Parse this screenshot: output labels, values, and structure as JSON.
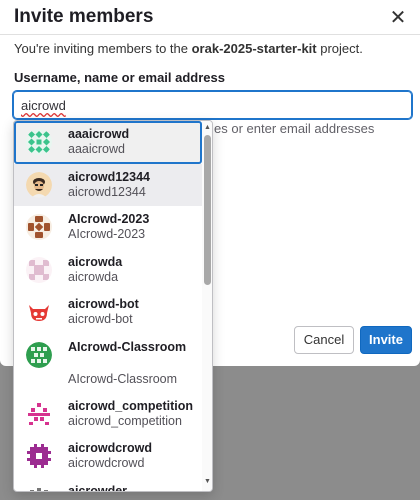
{
  "modal": {
    "title": "Invite members",
    "close_glyph": "✕",
    "intro_prefix": "You're inviting members to the ",
    "project": "orak-2025-starter-kit",
    "intro_suffix": " project.",
    "field_label": "Username, name or email address",
    "search_value": "aicrowd",
    "help_text": "es or enter email addresses",
    "cancel_label": "Cancel",
    "invite_label": "Invite"
  },
  "dropdown": {
    "items": [
      {
        "name": "aaaicrowd",
        "username": "aaaicrowd",
        "avatar": "identicon-green-icon"
      },
      {
        "name": "aicrowd12344",
        "username": "aicrowd12344",
        "avatar": "person-avatar-icon"
      },
      {
        "name": "AIcrowd-2023",
        "username": "AIcrowd-2023",
        "avatar": "identicon-brown-icon"
      },
      {
        "name": "aicrowda",
        "username": "aicrowda",
        "avatar": "identicon-pink-icon"
      },
      {
        "name": "aicrowd-bot",
        "username": "aicrowd-bot",
        "avatar": "red-robot-icon"
      },
      {
        "name": "AIcrowd-Classroom",
        "username": "AIcrowd-Classroom",
        "avatar": "identicon-green-dark-icon"
      },
      {
        "name": "aicrowd_competition",
        "username": "aicrowd_competition",
        "avatar": "identicon-magenta-icon"
      },
      {
        "name": "aicrowdcrowd",
        "username": "aicrowdcrowd",
        "avatar": "identicon-purple-icon"
      },
      {
        "name": "aicrowder",
        "username": "",
        "avatar": "identicon-grey-icon"
      }
    ],
    "scroll_up_glyph": "▲",
    "scroll_down_glyph": "▼"
  },
  "colors": {
    "accent": "#1f75cb",
    "overlay": "#8c8c8c"
  }
}
